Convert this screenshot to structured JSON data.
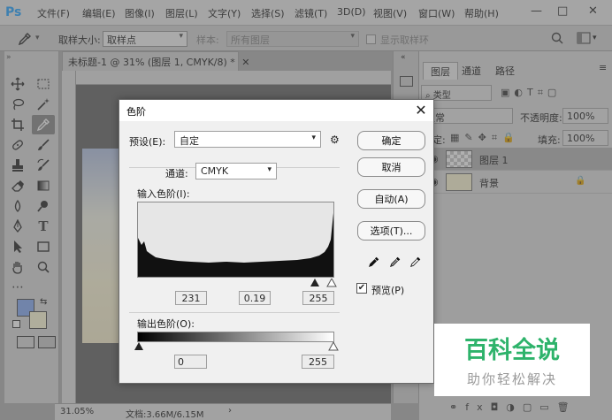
{
  "app": {
    "logo": "Ps",
    "menu": [
      "文件(F)",
      "编辑(E)",
      "图像(I)",
      "图层(L)",
      "文字(Y)",
      "选择(S)",
      "滤镜(T)",
      "3D(D)",
      "视图(V)",
      "窗口(W)",
      "帮助(H)"
    ],
    "window_controls": {
      "minimize": "—",
      "maximize": "□",
      "close": "✕"
    }
  },
  "options_bar": {
    "sample_size_label": "取样大小:",
    "sample_size_value": "取样点",
    "sample_label": "样本:",
    "sample_value": "所有图层",
    "show_ring_label": "显示取样环"
  },
  "document": {
    "tab_title": "未标题-1 @ 31% (图层 1, CMYK/8) *",
    "zoom": "31.05%",
    "doc_size": "文档:3.66M/6.15M"
  },
  "layers_panel": {
    "tabs": [
      "图层",
      "通道",
      "路径"
    ],
    "kind_label": "类型",
    "blend_mode": "正常",
    "opacity_label": "不透明度:",
    "opacity_value": "100%",
    "lock_label": "锁定:",
    "fill_label": "填充:",
    "fill_value": "100%",
    "layers": [
      {
        "name": "图层 1"
      },
      {
        "name": "背景"
      }
    ]
  },
  "levels_dialog": {
    "title": "色阶",
    "close_glyph": "✕",
    "preset_label": "预设(E):",
    "preset_value": "自定",
    "channel_label": "通道:",
    "channel_value": "CMYK",
    "input_levels_label": "输入色阶(I):",
    "input_values": {
      "black": "231",
      "gamma": "0.19",
      "white": "255"
    },
    "output_levels_label": "输出色阶(O):",
    "output_values": {
      "black": "0",
      "white": "255"
    },
    "buttons": {
      "ok": "确定",
      "cancel": "取消",
      "auto": "自动(A)",
      "options": "选项(T)..."
    },
    "preview_label": "预览(P)",
    "preview_checked": true
  },
  "watermark": {
    "main": "百科全说",
    "sub": "助你轻松解决"
  }
}
